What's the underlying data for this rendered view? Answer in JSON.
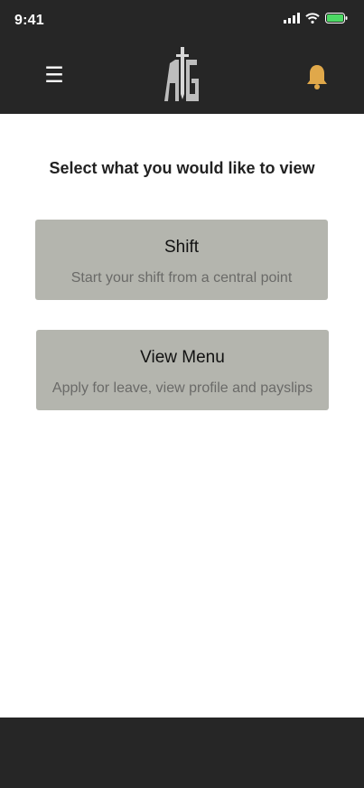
{
  "status_bar": {
    "time": "9:41",
    "icons": [
      "signal-icon",
      "wifi-icon",
      "battery-icon"
    ]
  },
  "header": {
    "menu_icon_glyph": "☰",
    "logo_letters": "AIG",
    "bell_color": "#e0a84a"
  },
  "main": {
    "title": "Select what you would like to view",
    "cards": [
      {
        "title": "Shift",
        "subtitle": "Start your shift from a central point"
      },
      {
        "title": "View Menu",
        "subtitle": "Apply for leave, view profile and payslips"
      }
    ]
  },
  "colors": {
    "bar_background": "#262626",
    "card_background": "#b4b5ae",
    "accent_bell": "#e0a84a",
    "battery_green": "#4cd964"
  }
}
